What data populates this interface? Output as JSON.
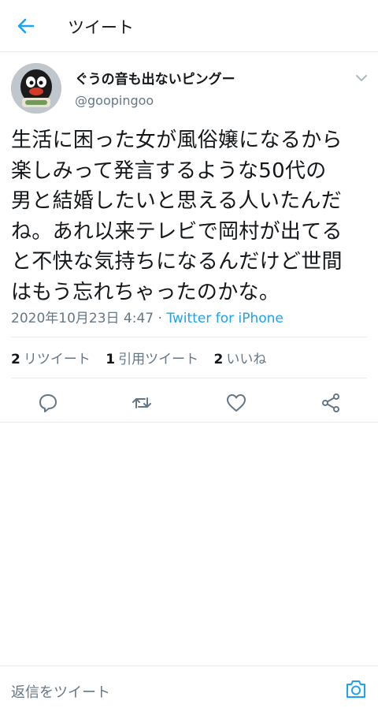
{
  "header": {
    "title": "ツイート",
    "back_icon": "arrow-left-icon"
  },
  "tweet": {
    "author_name": "ぐうの音も出ないピングー",
    "author_handle": "@goopingoo",
    "text_lines": [
      "生活に困った女が風俗嬢になるから",
      "楽しみって発言するような50代の",
      "男と結婚したいと思える人いたんだ",
      "ね。あれ以来テレビで岡村が出てる",
      "と不快な気持ちになるんだけど世間",
      "はもう忘れちゃったのかな。"
    ],
    "timestamp": "2020年10月23日 4:47",
    "separator": " · ",
    "source": "Twitter for iPhone"
  },
  "stats": {
    "retweets_count": "2",
    "retweets_label": "リツイート",
    "quotes_count": "1",
    "quotes_label": "引用ツイート",
    "likes_count": "2",
    "likes_label": "いいね"
  },
  "actions": [
    "reply-icon",
    "retweet-icon",
    "like-icon",
    "share-icon"
  ],
  "reply_bar": {
    "placeholder": "返信をツイート",
    "camera_icon": "camera-icon"
  },
  "colors": {
    "accent": "#1da1f2",
    "secondary_text": "#657786",
    "divider": "#e6ecf0"
  }
}
